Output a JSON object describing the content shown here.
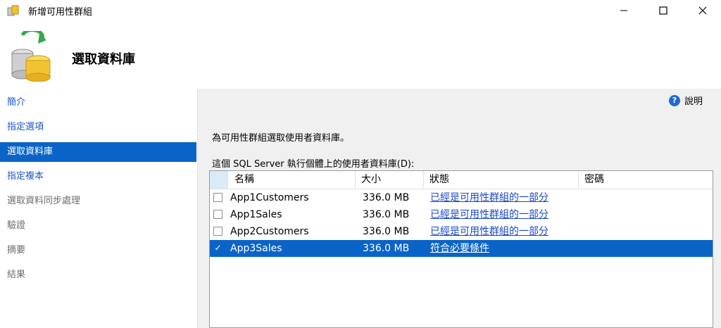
{
  "window": {
    "title": "新增可用性群組",
    "controls": {
      "minimize": "—",
      "maximize": "☐",
      "close": "✕"
    }
  },
  "header": {
    "title": "選取資料庫",
    "icon": "database-sync-icon"
  },
  "nav": {
    "items": [
      {
        "label": "簡介",
        "state": "link"
      },
      {
        "label": "指定選項",
        "state": "link"
      },
      {
        "label": "選取資料庫",
        "state": "selected"
      },
      {
        "label": "指定複本",
        "state": "link"
      },
      {
        "label": "選取資料同步處理",
        "state": "disabled"
      },
      {
        "label": "驗證",
        "state": "disabled"
      },
      {
        "label": "摘要",
        "state": "disabled"
      },
      {
        "label": "結果",
        "state": "disabled"
      }
    ]
  },
  "content": {
    "help": {
      "label": "說明",
      "icon": "help-icon"
    },
    "instruction": "為可用性群組選取使用者資料庫。",
    "grid_label": "這個 SQL Server 執行個體上的使用者資料庫(D):"
  },
  "grid": {
    "columns": [
      "名稱",
      "大小",
      "狀態",
      "密碼"
    ],
    "rows": [
      {
        "name": "App1Customers",
        "size": "336.0 MB",
        "status": "已經是可用性群組的一部分",
        "password": "",
        "checked": false,
        "selected": false
      },
      {
        "name": "App1Sales",
        "size": "336.0 MB",
        "status": "已經是可用性群組的一部分",
        "password": "",
        "checked": false,
        "selected": false
      },
      {
        "name": "App2Customers",
        "size": "336.0 MB",
        "status": "已經是可用性群組的一部分",
        "password": "",
        "checked": false,
        "selected": false
      },
      {
        "name": "App3Sales",
        "size": "336.0 MB",
        "status": "符合必要條件",
        "password": "",
        "checked": true,
        "selected": true
      }
    ]
  },
  "colors": {
    "accent": "#0a64c8",
    "link": "#1c48c8",
    "pane_bg": "#f0f0f0"
  }
}
